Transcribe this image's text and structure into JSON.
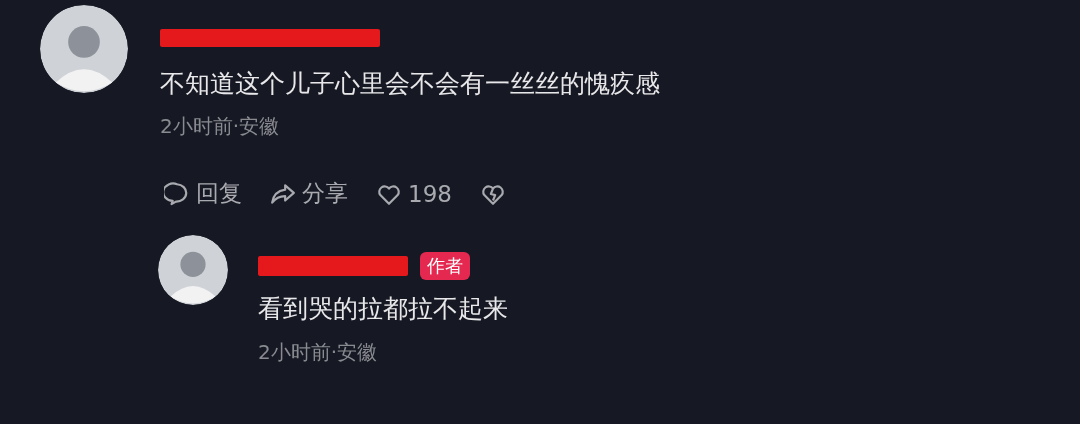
{
  "comment": {
    "text": "不知道这个儿子心里会不会有一丝丝的愧疚感",
    "meta": "2小时前·安徽",
    "actions": [
      {
        "kind": "reply",
        "label": "回复"
      },
      {
        "kind": "share",
        "label": "分享"
      },
      {
        "kind": "like",
        "label": "198"
      },
      {
        "kind": "dislike"
      }
    ],
    "replies": [
      {
        "badge": "作者",
        "text": "看到哭的拉都拉不起来",
        "meta": "2小时前·安徽"
      }
    ]
  }
}
